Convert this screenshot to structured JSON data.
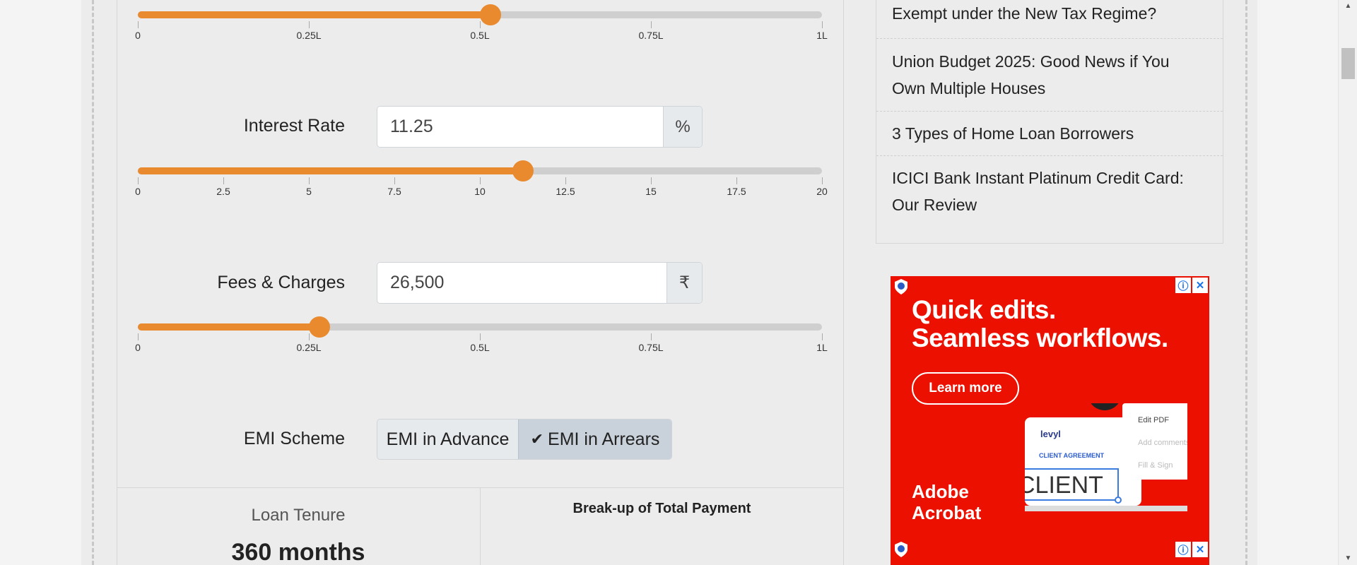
{
  "calculator": {
    "principal_slider": {
      "value_fraction": 0.515,
      "ticks": [
        "0",
        "0.25L",
        "0.5L",
        "0.75L",
        "1L"
      ]
    },
    "interest_rate": {
      "label": "Interest Rate",
      "value": "11.25",
      "unit": "%",
      "slider_value": 11.25,
      "slider_max": 20,
      "ticks": [
        "0",
        "2.5",
        "5",
        "7.5",
        "10",
        "12.5",
        "15",
        "17.5",
        "20"
      ]
    },
    "fees": {
      "label": "Fees & Charges",
      "value": "26,500",
      "unit": "₹",
      "slider_value_fraction": 0.265,
      "ticks": [
        "0",
        "0.25L",
        "0.5L",
        "0.75L",
        "1L"
      ]
    },
    "emi_scheme": {
      "label": "EMI Scheme",
      "options": [
        "EMI in Advance",
        "EMI in Arrears"
      ],
      "selected": "EMI in Arrears",
      "check": "✔"
    },
    "results": {
      "tenure_label": "Loan Tenure",
      "tenure_value": "360 months",
      "breakup_title": "Break-up of Total Payment"
    }
  },
  "sidebar": {
    "items": [
      "Exempt under the New Tax Regime?",
      "Union Budget 2025: Good News if You Own Multiple Houses",
      "3 Types of Home Loan Borrowers",
      "ICICI Bank Instant Platinum Credit Card: Our Review"
    ]
  },
  "ad": {
    "headline_1": "Quick edits.",
    "headline_2": "Seamless workflows.",
    "cta": "Learn more",
    "brand_1": "Adobe",
    "brand_2": "Acrobat",
    "mock_logo": "levyl",
    "mock_title": "CLIENT AGREEMENT",
    "mock_word": "CLIENT",
    "menu_items": [
      "Edit PDF",
      "Add comments",
      "Fill & Sign"
    ],
    "info_icon": "ⓘ",
    "close_icon": "✕",
    "colors": {
      "background": "#eb1000",
      "accent": "#ffffff"
    }
  },
  "colors": {
    "slider_accent": "#e98a2f",
    "track": "#cfcfcf"
  }
}
